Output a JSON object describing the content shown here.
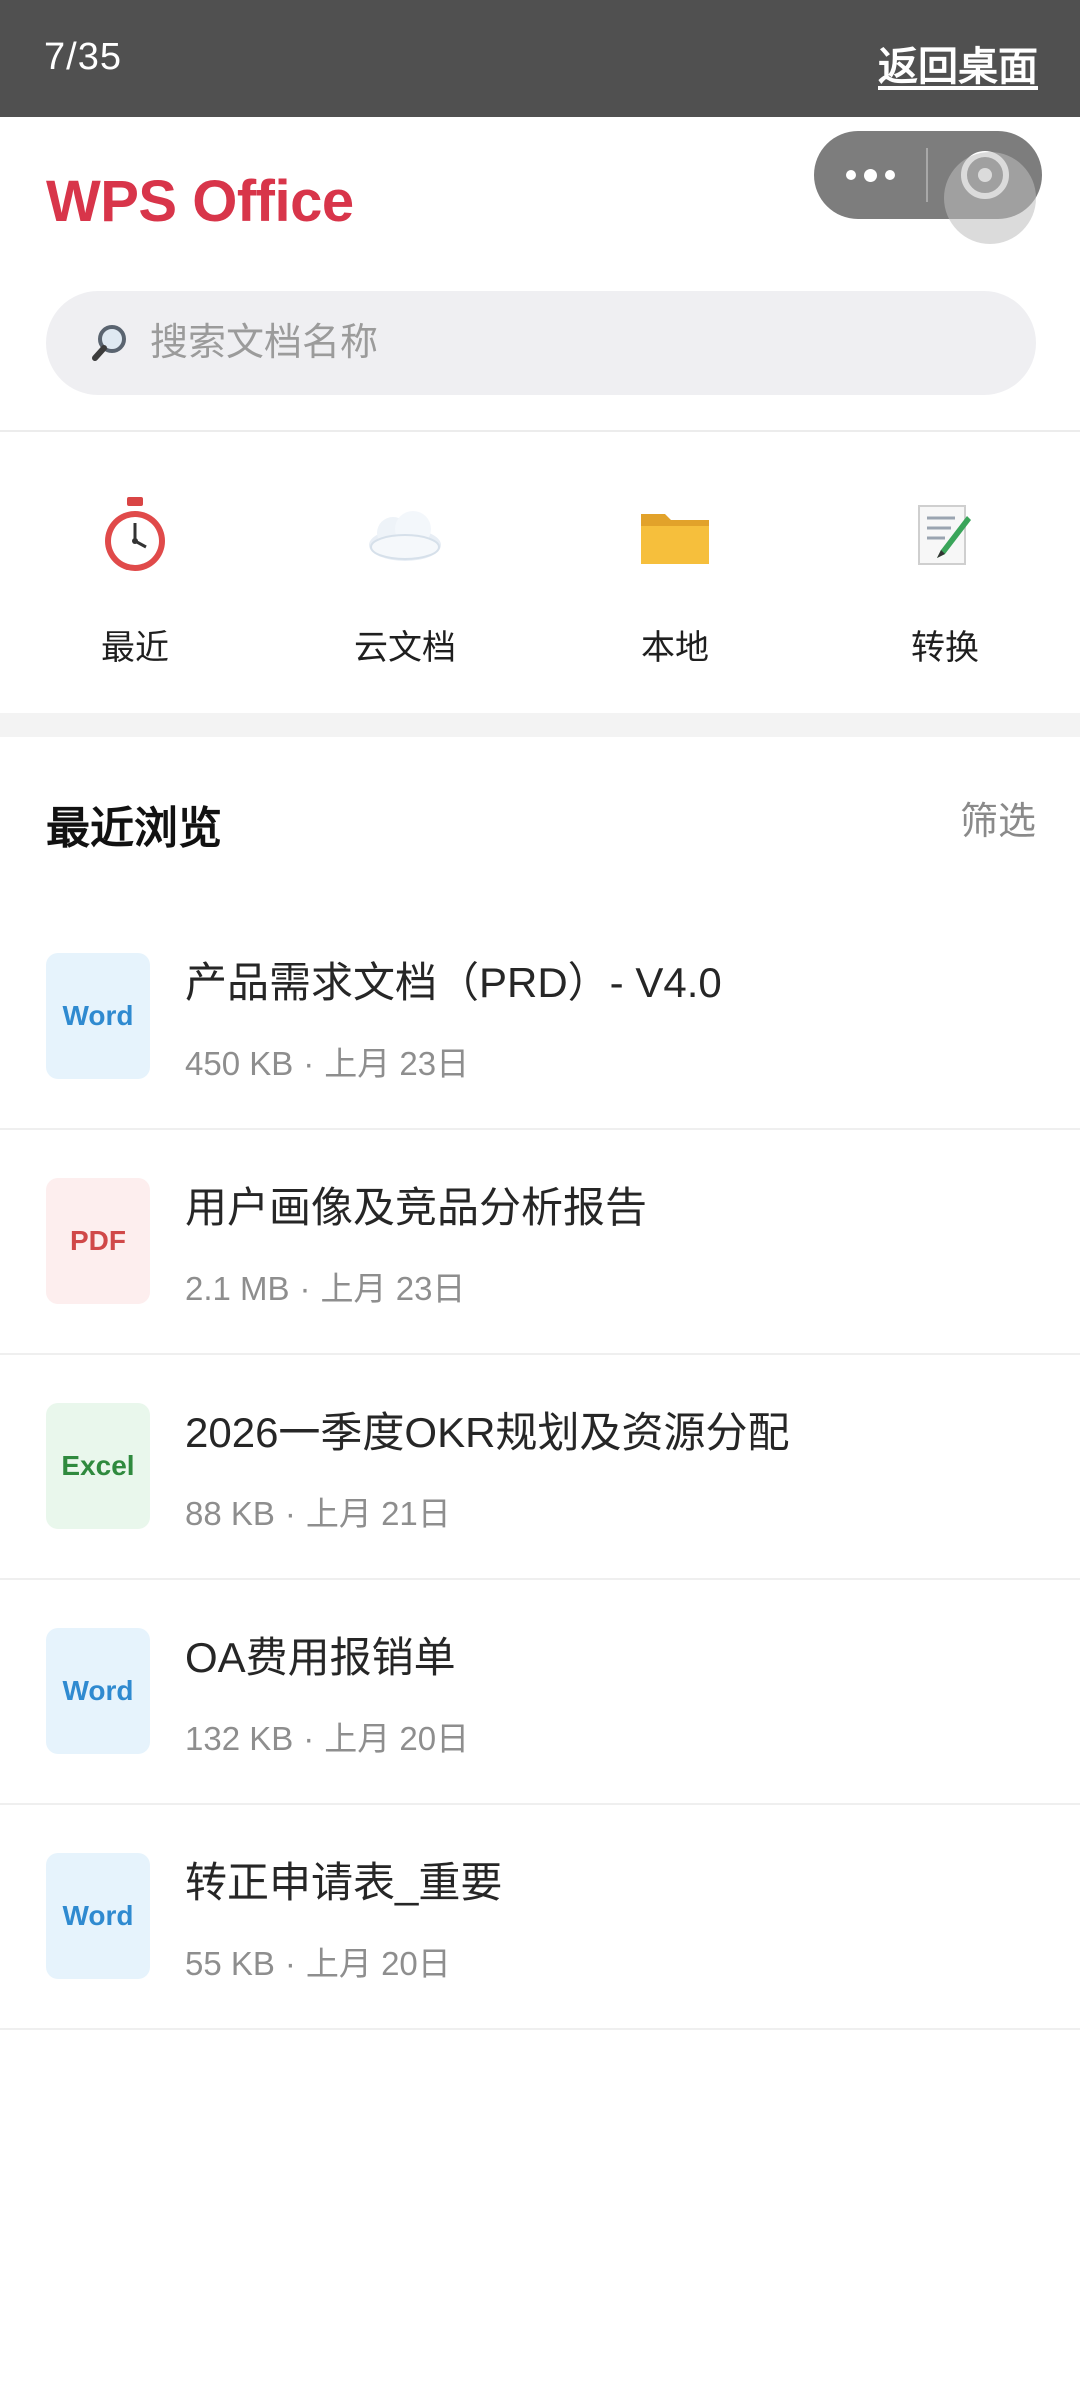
{
  "status_bar": {
    "counter": "7/35",
    "back_desktop": "返回桌面"
  },
  "header": {
    "app_title": "WPS Office",
    "capsule": {
      "more_icon": "more-dots-icon",
      "close_icon": "target-circle-icon"
    }
  },
  "search": {
    "placeholder": "搜索文档名称",
    "value": ""
  },
  "quick_entries": [
    {
      "label": "最近",
      "icon": "stopwatch-icon"
    },
    {
      "label": "云文档",
      "icon": "cloud-icon"
    },
    {
      "label": "本地",
      "icon": "folder-icon"
    },
    {
      "label": "转换",
      "icon": "memo-pencil-icon"
    }
  ],
  "recent": {
    "title": "最近浏览",
    "filter_label": "筛选",
    "files": [
      {
        "type": "Word",
        "name": "产品需求文档（PRD）- V4.0",
        "size": "450 KB",
        "date": "上月 23日"
      },
      {
        "type": "PDF",
        "name": "用户画像及竞品分析报告",
        "size": "2.1 MB",
        "date": "上月 23日"
      },
      {
        "type": "Excel",
        "name": "2026一季度OKR规划及资源分配",
        "size": "88 KB",
        "date": "上月 21日"
      },
      {
        "type": "Word",
        "name": "OA费用报销单",
        "size": "132 KB",
        "date": "上月 20日"
      },
      {
        "type": "Word",
        "name": "转正申请表_重要",
        "size": "55 KB",
        "date": "上月 20日"
      }
    ]
  },
  "colors": {
    "brand": "#d8354a",
    "status_bar_bg": "#505050",
    "word_bg": "#e6f3fc",
    "word_fg": "#2f8ad0",
    "pdf_bg": "#fdeeee",
    "pdf_fg": "#d04848",
    "excel_bg": "#e9f7ec",
    "excel_fg": "#2f8a3e"
  },
  "separator": "·"
}
